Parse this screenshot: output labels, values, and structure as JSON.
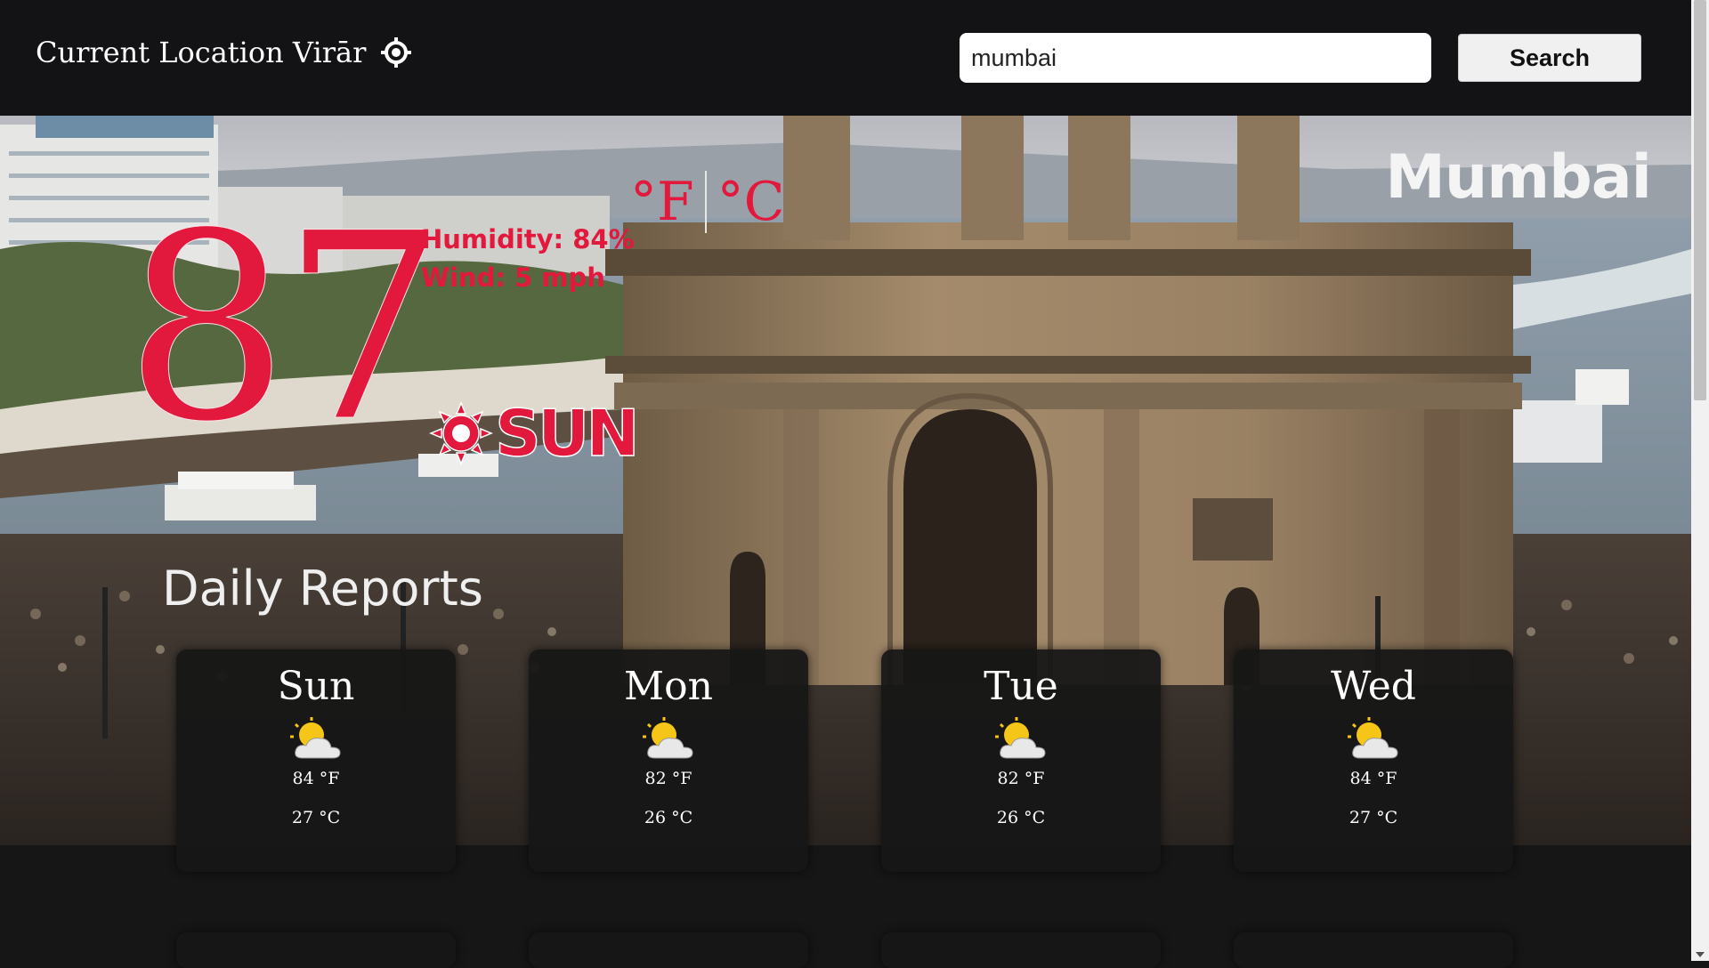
{
  "header": {
    "current_location_label": "Current Location Virār",
    "search_value": "mumbai",
    "search_button": "Search"
  },
  "weather": {
    "city": "Mumbai",
    "temperature": "87",
    "unit_f": "°F",
    "unit_c": "°C",
    "humidity": "Humidity: 84%",
    "wind": "Wind: 5 mph",
    "condition": "SUN"
  },
  "daily": {
    "title": "Daily Reports",
    "days": [
      {
        "day": "Sun",
        "temp_f": "84 °F",
        "temp_c": "27 °C",
        "icon": "partly-sunny-icon"
      },
      {
        "day": "Mon",
        "temp_f": "82 °F",
        "temp_c": "26 °C",
        "icon": "partly-sunny-icon"
      },
      {
        "day": "Tue",
        "temp_f": "82 °F",
        "temp_c": "26 °C",
        "icon": "partly-sunny-icon"
      },
      {
        "day": "Wed",
        "temp_f": "84 °F",
        "temp_c": "27 °C",
        "icon": "partly-sunny-icon"
      }
    ]
  },
  "colors": {
    "accent_red": "#e2183d",
    "topbar_bg": "#131315",
    "card_bg": "#161616"
  }
}
